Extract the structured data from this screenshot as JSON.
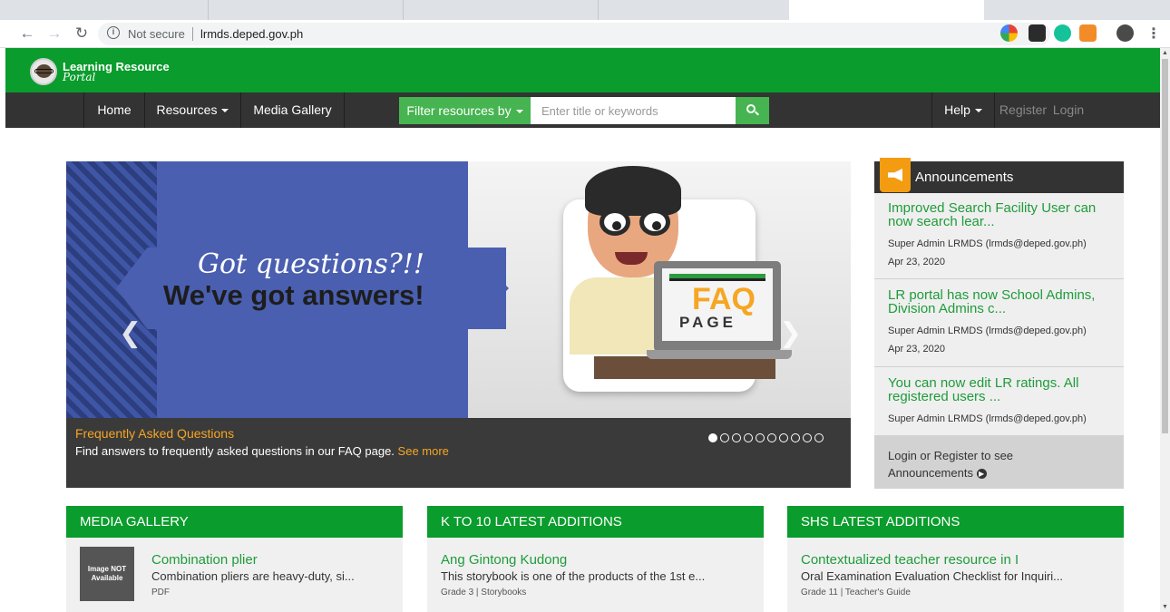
{
  "browser": {
    "url_security": "Not secure",
    "url": "lrmds.deped.gov.ph"
  },
  "site": {
    "logo_title": "Learning Resource",
    "logo_subtitle": "Portal"
  },
  "nav": {
    "home": "Home",
    "resources": "Resources",
    "media_gallery": "Media Gallery",
    "filter": "Filter resources by",
    "search_placeholder": "Enter title or keywords",
    "help": "Help",
    "register": "Register",
    "login": "Login"
  },
  "carousel": {
    "hero_line1": "Got questions?!!",
    "hero_line2": "We've got answers!",
    "faq_word": "FAQ",
    "page_word": "PAGE",
    "caption_title": "Frequently Asked Questions",
    "caption_text": "Find answers to frequently asked questions in our FAQ page.",
    "caption_link": "See more",
    "slide_count": 10,
    "active_slide": 1
  },
  "announcements": {
    "title": "Announcements",
    "items": [
      {
        "title": "Improved Search Facility User can now search lear...",
        "by": "Super Admin LRMDS (lrmds@deped.gov.ph)",
        "date": "Apr 23, 2020"
      },
      {
        "title": "LR portal has now School Admins, Division Admins c...",
        "by": "Super Admin LRMDS (lrmds@deped.gov.ph)",
        "date": "Apr 23, 2020"
      },
      {
        "title": "You can now edit LR ratings. All registered users ...",
        "by": "Super Admin LRMDS (lrmds@deped.gov.ph)",
        "date": ""
      }
    ],
    "footer": "Login or Register to see Announcements"
  },
  "panels": [
    {
      "title": "MEDIA GALLERY",
      "image_placeholder": "Image NOT Available",
      "item_title": "Combination plier",
      "item_desc": "Combination pliers are heavy-duty, si...",
      "item_meta": "PDF"
    },
    {
      "title": "K TO 10 LATEST ADDITIONS",
      "item_title": "Ang Gintong Kudong",
      "item_desc": "This storybook is one of the products of the 1st e...",
      "item_meta": "Grade 3 | Storybooks"
    },
    {
      "title": "SHS LATEST ADDITIONS",
      "item_title": "Contextualized teacher resource in I",
      "item_desc": "Oral Examination Evaluation Checklist for Inquiri...",
      "item_meta": "Grade 11 | Teacher's Guide"
    }
  ],
  "colors": {
    "brand_green": "#0a9c2c",
    "link_green": "#1e9c3a",
    "accent_orange": "#f5a623",
    "nav_dark": "#333333"
  }
}
